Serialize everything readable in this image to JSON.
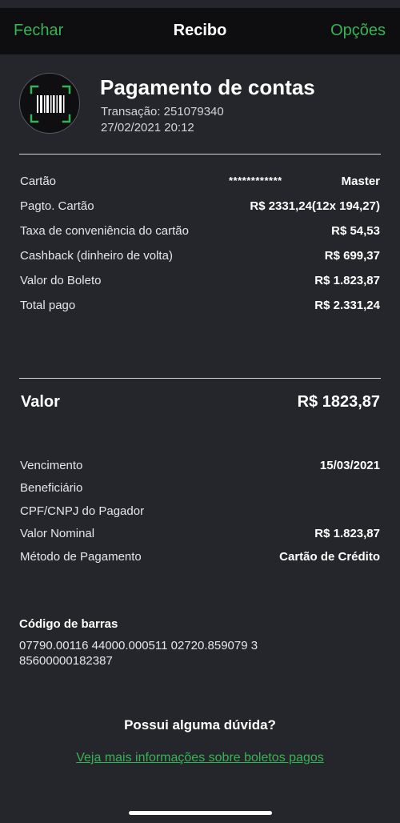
{
  "nav": {
    "close_label": "Fechar",
    "title": "Recibo",
    "options_label": "Opções"
  },
  "header": {
    "icon": "barcode-scan-icon",
    "title": "Pagamento de contas",
    "transaction": "Transação: 251079340",
    "datetime": "27/02/2021 20:12"
  },
  "payment": {
    "card_label": "Cartão",
    "card_masked": "************",
    "card_brand": "Master",
    "rows": [
      {
        "label": "Pagto. Cartão",
        "value": "R$ 2331,24(12x 194,27)"
      },
      {
        "label": "Taxa de conveniência do cartão",
        "value": "R$ 54,53"
      },
      {
        "label": "Cashback (dinheiro de volta)",
        "value": "R$ 699,37"
      },
      {
        "label": "Valor do Boleto",
        "value": "R$ 1.823,87"
      },
      {
        "label": "Total pago",
        "value": "R$ 2.331,24"
      }
    ]
  },
  "valor": {
    "label": "Valor",
    "value": "R$ 1823,87"
  },
  "details": {
    "rows": [
      {
        "label": "Vencimento",
        "value": "15/03/2021"
      },
      {
        "label": "Beneficiário",
        "value": ""
      },
      {
        "label": "CPF/CNPJ do Pagador",
        "value": ""
      },
      {
        "label": "Valor Nominal",
        "value": "R$ 1.823,87"
      },
      {
        "label": "Método de Pagamento",
        "value": "Cartão de Crédito"
      }
    ]
  },
  "barcode": {
    "title": "Código de barras",
    "line1": "07790.00116 44000.000511 02720.859079 3",
    "line2": "85600000182387"
  },
  "help": {
    "question": "Possui alguma dúvida?",
    "link": "Veja mais informações sobre boletos pagos"
  },
  "colors": {
    "background": "#25262b",
    "navbar": "#0e0e10",
    "accent": "#36b354"
  }
}
